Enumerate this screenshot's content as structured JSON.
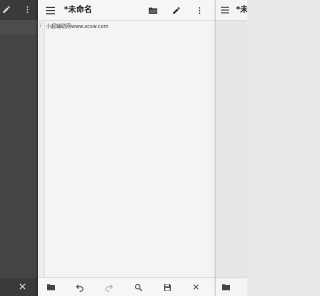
{
  "left_panel": {
    "icons": [
      "edit-icon",
      "more-vert-icon",
      "close-icon"
    ]
  },
  "main": {
    "toolbar": {
      "icons": [
        "menu-icon",
        "folder-open-icon",
        "edit-icon",
        "more-vert-icon"
      ],
      "title": "*未命名"
    },
    "editor": {
      "line_number": "1",
      "text": "小超辅助网www.xcsw.com"
    },
    "bottom_bar": {
      "icons": [
        "folder-icon",
        "undo-icon",
        "redo-icon",
        "search-icon",
        "save-icon",
        "close-icon",
        "folder-open-icon"
      ]
    }
  },
  "right_panel": {
    "title": "*未",
    "icons": [
      "menu-icon",
      "folder-icon"
    ]
  },
  "colors": {
    "left_panel": "#444444",
    "main_background": "#f2f2f2",
    "toolbar": "#f6f6f6",
    "icon": "#333333"
  }
}
